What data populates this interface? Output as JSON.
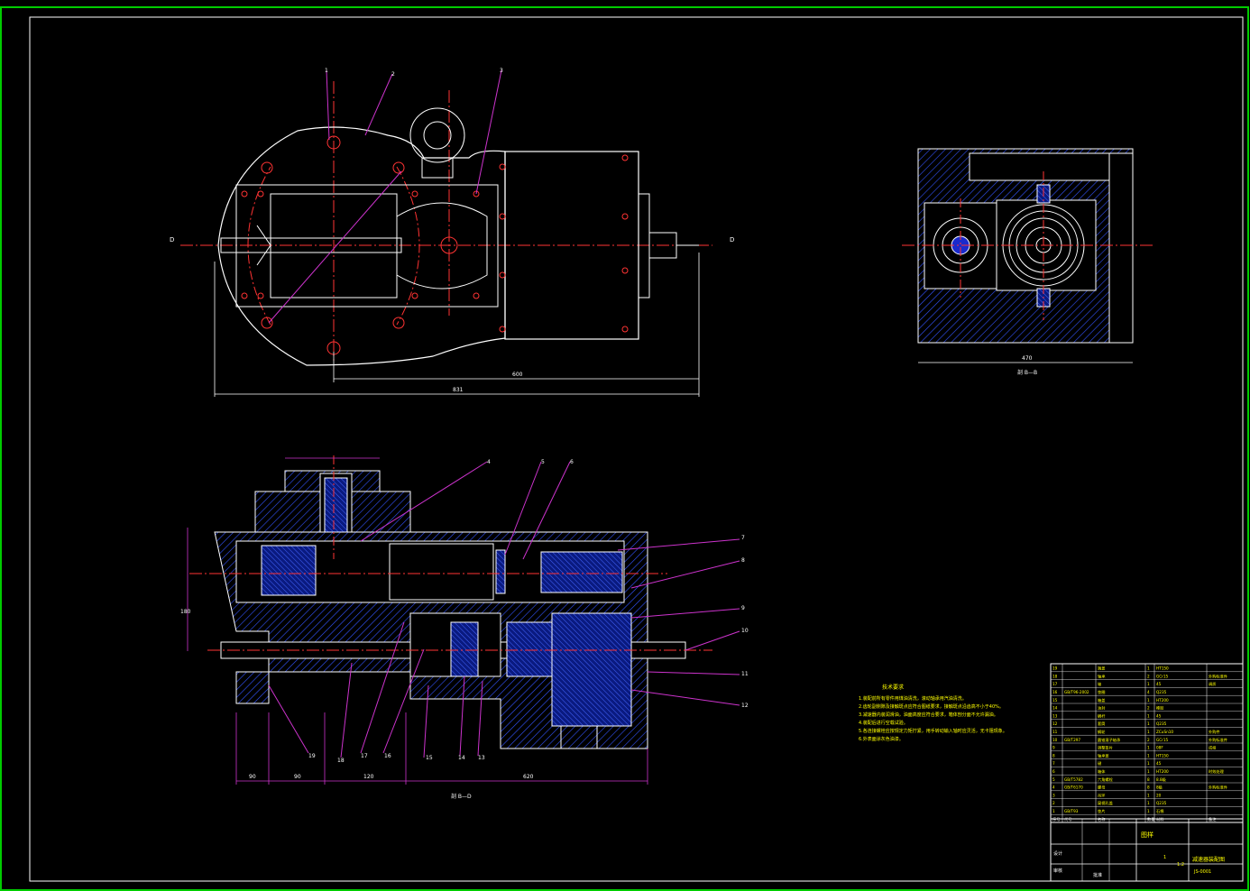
{
  "drawing": {
    "section_labels": {
      "top_left_marker": "D",
      "top_right_marker": "D",
      "top_right_view_caption": "剖 B—B",
      "bottom_view_caption": "剖 B—D"
    },
    "dimensions": {
      "top_view_overall": "831",
      "top_view_partial": "600",
      "right_view_width": "470",
      "bottom_view_overall": "620",
      "bottom_view_left": "90",
      "bottom_view_mid": "90",
      "bottom_view_mid2": "120",
      "bottom_view_height": "180"
    },
    "callouts_top": [
      "1",
      "2",
      "3"
    ],
    "callouts_bottom_right": [
      "7",
      "8",
      "9",
      "10",
      "11",
      "12"
    ],
    "callouts_bottom": [
      "4",
      "5",
      "6",
      "13",
      "14",
      "15",
      "16",
      "17",
      "18",
      "19"
    ],
    "tech_notes_title": "技术要求",
    "tech_notes": [
      "1.装配前所有零件用煤油清洗，滚动轴承用汽油清洗。",
      "2.齿轮副侧隙及接触斑点应符合图纸要求，接触斑点沿齿高不小于40%。",
      "3.减速器内装润滑油，油面高度应符合要求，箱体剖分面不允许漏油。",
      "4.装配后进行空载试验。",
      "5.各连接螺栓应按规定力矩拧紧，用手转动输入轴时应灵活，无卡阻现象。",
      "6.外表面涂灰色油漆。"
    ],
    "title_block": {
      "main_title": "减速器装配图",
      "group_label": "图样",
      "drawing_no": "JS-0001",
      "scale": "1:2",
      "sheet": "1",
      "designer": "设计",
      "checker": "审核",
      "approver": "批准"
    },
    "bom_rows": [
      [
        "19",
        "",
        "端盖",
        "1",
        "HT150",
        ""
      ],
      [
        "18",
        "",
        "轴承",
        "2",
        "GCr15",
        "外购标准件"
      ],
      [
        "17",
        "",
        "轴",
        "1",
        "45",
        "调质"
      ],
      [
        "16",
        "GB/T96-2002",
        "垫圈",
        "4",
        "Q235",
        ""
      ],
      [
        "15",
        "",
        "箱盖",
        "1",
        "HT200",
        ""
      ],
      [
        "14",
        "",
        "油封",
        "2",
        "橡胶",
        ""
      ],
      [
        "13",
        "",
        "蜗杆",
        "1",
        "45",
        ""
      ],
      [
        "12",
        "",
        "套筒",
        "1",
        "Q235",
        ""
      ],
      [
        "11",
        "",
        "蜗轮",
        "1",
        "ZCuSn10",
        "外购件"
      ],
      [
        "10",
        "GB/T297",
        "圆锥滚子轴承",
        "2",
        "GCr15",
        "外购标准件"
      ],
      [
        "9",
        "",
        "调整垫片",
        "1",
        "08F",
        "成组"
      ],
      [
        "8",
        "",
        "轴承盖",
        "1",
        "HT150",
        ""
      ],
      [
        "7",
        "",
        "键",
        "1",
        "45",
        ""
      ],
      [
        "6",
        "",
        "箱体",
        "1",
        "HT200",
        "时效处理"
      ],
      [
        "5",
        "GB/T5782",
        "六角螺栓",
        "8",
        "8.8级",
        ""
      ],
      [
        "4",
        "GB/T6170",
        "螺母",
        "8",
        "8级",
        "外购标准件"
      ],
      [
        "3",
        "",
        "吊环",
        "1",
        "20",
        ""
      ],
      [
        "2",
        "",
        "窥视孔盖",
        "1",
        "Q235",
        ""
      ],
      [
        "1",
        "GB/T93",
        "垫片",
        "1",
        "石棉",
        ""
      ]
    ],
    "bom_header": [
      "序号",
      "代号",
      "名称",
      "数量",
      "材料",
      "备注"
    ]
  }
}
